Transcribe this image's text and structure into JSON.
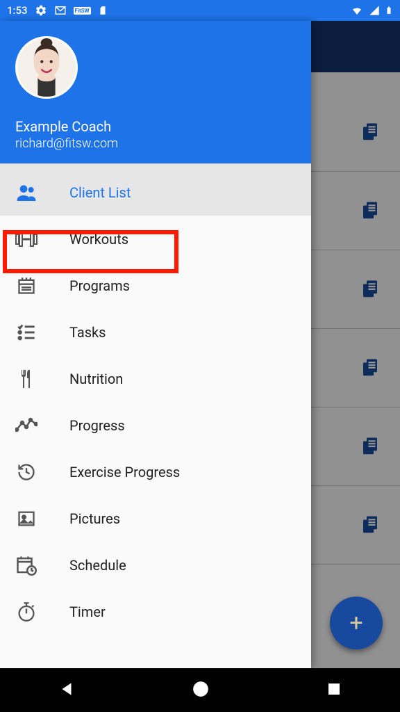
{
  "status": {
    "time": "1:53"
  },
  "header": {
    "name": "Example Coach",
    "email": "richard@fitsw.com"
  },
  "drawer": {
    "items": [
      {
        "label": "Client List"
      },
      {
        "label": "Workouts"
      },
      {
        "label": "Programs"
      },
      {
        "label": "Tasks"
      },
      {
        "label": "Nutrition"
      },
      {
        "label": "Progress"
      },
      {
        "label": "Exercise Progress"
      },
      {
        "label": "Pictures"
      },
      {
        "label": "Schedule"
      },
      {
        "label": "Timer"
      }
    ]
  },
  "fab": {
    "label": "+"
  }
}
